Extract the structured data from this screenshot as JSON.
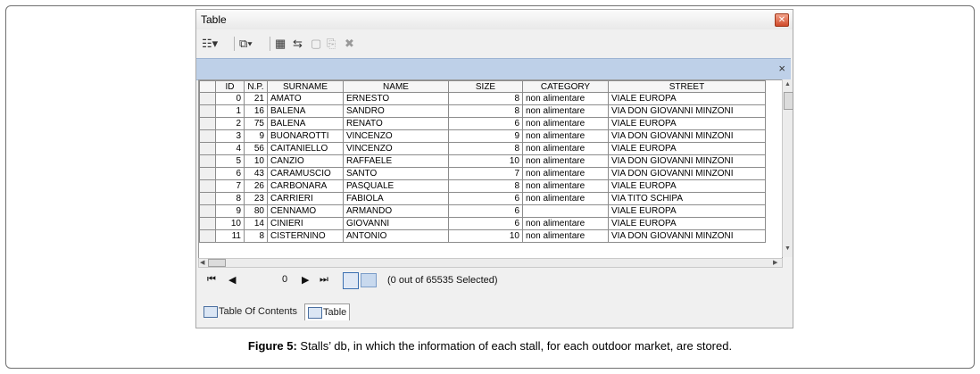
{
  "window": {
    "title": "Table"
  },
  "toolbar": {
    "close_label": "×"
  },
  "grid": {
    "columns": [
      "ID",
      "N.P.",
      "SURNAME",
      "NAME",
      "SIZE",
      "CATEGORY",
      "STREET"
    ],
    "rows": [
      [
        "0",
        "21",
        "AMATO",
        "ERNESTO",
        "8",
        "non alimentare",
        "VIALE EUROPA"
      ],
      [
        "1",
        "16",
        "BALENA",
        "SANDRO",
        "8",
        "non alimentare",
        "VIA DON GIOVANNI MINZONI"
      ],
      [
        "2",
        "75",
        "BALENA",
        "RENATO",
        "6",
        "non alimentare",
        "VIALE EUROPA"
      ],
      [
        "3",
        "9",
        "BUONAROTTI",
        "VINCENZO",
        "9",
        "non alimentare",
        "VIA DON GIOVANNI MINZONI"
      ],
      [
        "4",
        "56",
        "CAITANIELLO",
        "VINCENZO",
        "8",
        "non alimentare",
        "VIALE EUROPA"
      ],
      [
        "5",
        "10",
        "CANZIO",
        "RAFFAELE",
        "10",
        "non alimentare",
        "VIA DON GIOVANNI MINZONI"
      ],
      [
        "6",
        "43",
        "CARAMUSCIO",
        "SANTO",
        "7",
        "non alimentare",
        "VIA DON GIOVANNI MINZONI"
      ],
      [
        "7",
        "26",
        "CARBONARA",
        "PASQUALE",
        "8",
        "non alimentare",
        "VIALE EUROPA"
      ],
      [
        "8",
        "23",
        "CARRIERI",
        "FABIOLA",
        "6",
        "non alimentare",
        "VIA TITO SCHIPA"
      ],
      [
        "9",
        "80",
        "CENNAMO",
        "ARMANDO",
        "6",
        "",
        "VIALE EUROPA"
      ],
      [
        "10",
        "14",
        "CINIERI",
        "GIOVANNI",
        "6",
        "non alimentare",
        "VIALE EUROPA"
      ],
      [
        "11",
        "8",
        "CISTERNINO",
        "ANTONIO",
        "10",
        "non alimentare",
        "VIA DON GIOVANNI MINZONI"
      ]
    ]
  },
  "navigation": {
    "record_number": "0",
    "status": "(0 out of 65535 Selected)"
  },
  "tabs": [
    {
      "label": "Table Of Contents",
      "icon": "toc-icon"
    },
    {
      "label": "Table",
      "icon": "table-icon"
    }
  ],
  "caption": {
    "label": "Figure 5:",
    "text": " Stalls’ db, in which the information of each stall, for each outdoor market, are stored."
  }
}
